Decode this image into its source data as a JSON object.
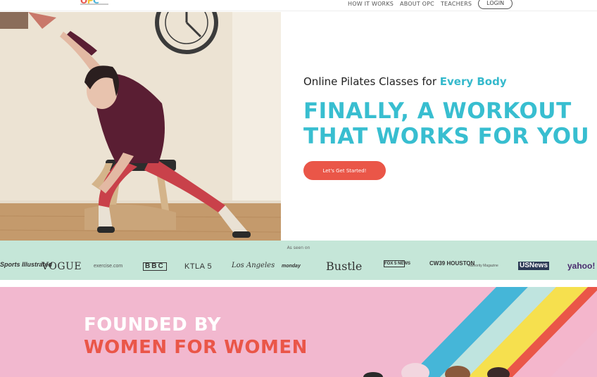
{
  "header": {
    "logo_text": "OPC",
    "nav": [
      "HOW IT WORKS",
      "ABOUT OPC",
      "TEACHERS"
    ],
    "login_label": "LOGIN"
  },
  "hero": {
    "subtitle_prefix": "Online Pilates Classes for ",
    "subtitle_accent": "Every Body",
    "headline_line1": "FINALLY, A WORKOUT",
    "headline_line2": "THAT WORKS FOR YOU",
    "cta_label": "Let's Get Started!"
  },
  "press": {
    "caption": "As seen on",
    "logos": [
      "Sports Illustrated",
      "VOGUE",
      "exercise.com",
      "BBC",
      "KTLA 5",
      "Los Angeles",
      "monday",
      "Bustle",
      "FOX 5 NEWS",
      "CW39 HOUSTON",
      "Authority Magazine",
      "USNews",
      "yahoo!"
    ]
  },
  "founded": {
    "line1": "FOUNDED BY",
    "line2": "WOMEN FOR WOMEN"
  },
  "colors": {
    "teal": "#38bed0",
    "coral": "#ea5648",
    "mint": "#c5e6d8",
    "pink": "#f2b8cf"
  }
}
